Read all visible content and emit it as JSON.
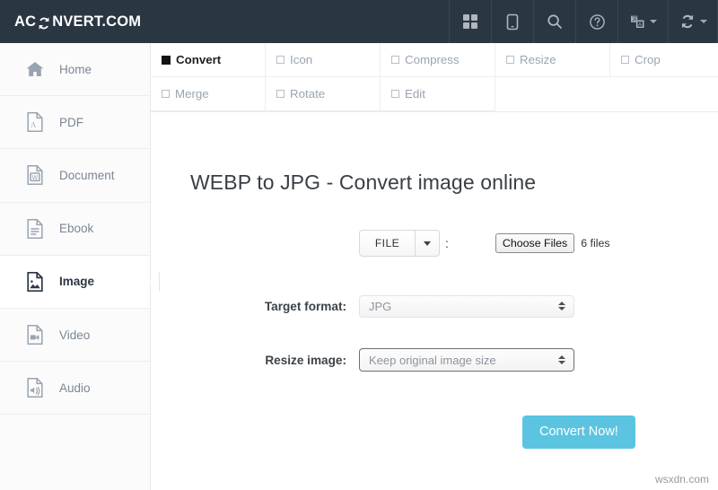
{
  "header": {
    "logo_prefix": "AC",
    "logo_suffix": "NVERT.COM",
    "logo_icon": "refresh-icon",
    "buttons": [
      {
        "name": "grid-icon",
        "label": "Apps"
      },
      {
        "name": "mobile-icon",
        "label": "Mobile"
      },
      {
        "name": "search-icon",
        "label": "Search"
      },
      {
        "name": "help-icon",
        "label": "Help"
      },
      {
        "name": "language-icon",
        "label": "Language"
      },
      {
        "name": "convert-refresh-icon",
        "label": "Convert"
      }
    ]
  },
  "sidebar": {
    "items": [
      {
        "label": "Home",
        "icon": "home-icon",
        "active": false
      },
      {
        "label": "PDF",
        "icon": "pdf-file-icon",
        "active": false
      },
      {
        "label": "Document",
        "icon": "word-file-icon",
        "active": false
      },
      {
        "label": "Ebook",
        "icon": "ebook-file-icon",
        "active": false
      },
      {
        "label": "Image",
        "icon": "image-file-icon",
        "active": true
      },
      {
        "label": "Video",
        "icon": "video-file-icon",
        "active": false
      },
      {
        "label": "Audio",
        "icon": "audio-file-icon",
        "active": false
      }
    ]
  },
  "tabs": {
    "row1": [
      {
        "label": "Convert",
        "active": true
      },
      {
        "label": "Icon",
        "active": false
      },
      {
        "label": "Compress",
        "active": false
      },
      {
        "label": "Resize",
        "active": false
      },
      {
        "label": "Crop",
        "active": false
      }
    ],
    "row2": [
      {
        "label": "Merge",
        "active": false
      },
      {
        "label": "Rotate",
        "active": false
      },
      {
        "label": "Edit",
        "active": false
      }
    ]
  },
  "main": {
    "title": "WEBP to JPG - Convert image online",
    "source_button": "FILE",
    "source_colon": ":",
    "choose_files_label": "Choose Files",
    "file_count": "6 files",
    "target_format_label": "Target format:",
    "target_format_value": "JPG",
    "resize_label": "Resize image:",
    "resize_value": "Keep original image size",
    "convert_button": "Convert Now!"
  },
  "watermark": "wsxdn.com",
  "colors": {
    "header_bg": "#2b3643",
    "accent_button": "#5bc4e0",
    "sidebar_bg": "#fbfbfc",
    "muted_text": "#9aa4b0"
  }
}
